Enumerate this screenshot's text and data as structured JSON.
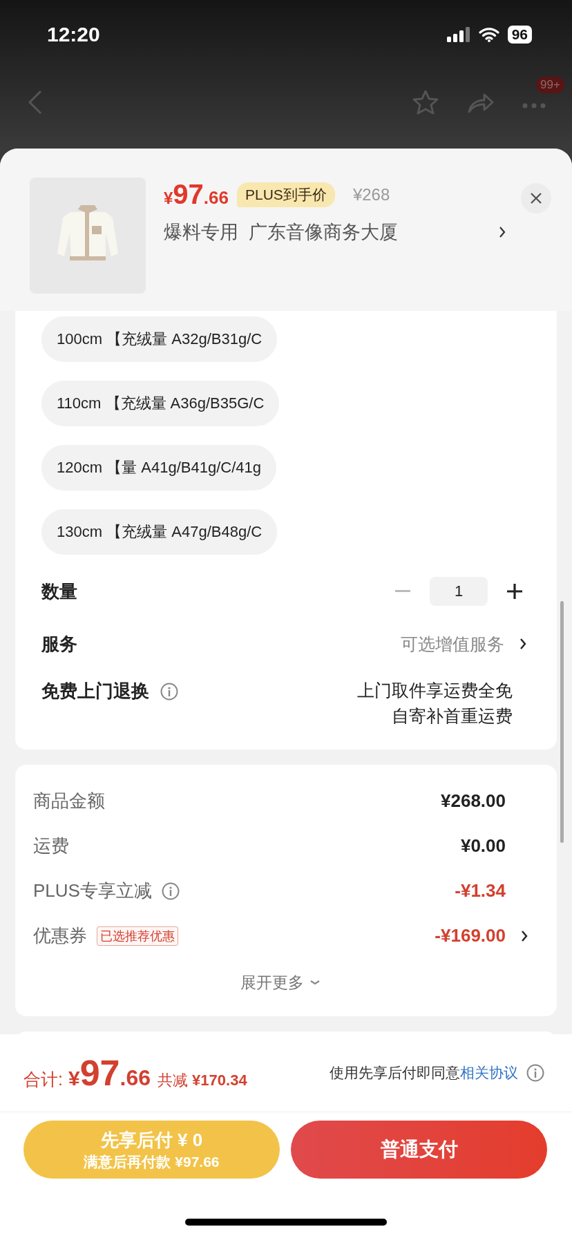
{
  "status_bar": {
    "time": "12:20",
    "battery": "96"
  },
  "nav": {
    "badge": "99+"
  },
  "product": {
    "price_symbol": "¥",
    "price_int": "97",
    "price_dec": ".66",
    "price_tag": "PLUS到手价",
    "original_price": "¥268",
    "name": "爆料专用  广东音像商务大厦"
  },
  "options": [
    {
      "label": "100cm 【充绒量 A32g/B31g/C",
      "selected": false
    },
    {
      "label": "110cm 【充绒量 A36g/B35G/C",
      "selected": false
    },
    {
      "label": "120cm 【量 A41g/B41g/C/41g",
      "selected": false
    },
    {
      "label": "130cm 【充绒量 A47g/B48g/C",
      "selected": false
    }
  ],
  "quantity": {
    "label": "数量",
    "value": "1",
    "minus_disabled": true
  },
  "service": {
    "label": "服务",
    "value": "可选增值服务"
  },
  "returns": {
    "label": "免费上门退换",
    "lines": [
      "上门取件享运费全免",
      "自寄补首重运费"
    ]
  },
  "summary": {
    "rows": [
      {
        "kind": "plain",
        "label": "商品金额",
        "value": "¥268.00",
        "discount": false
      },
      {
        "kind": "plain",
        "label": "运费",
        "value": "¥0.00",
        "discount": false
      },
      {
        "kind": "info",
        "label": "PLUS专享立减",
        "value": "-¥1.34",
        "discount": true
      },
      {
        "kind": "link",
        "label": "优惠券",
        "tag": "已选推荐优惠",
        "value": "-¥169.00",
        "discount": true
      }
    ],
    "expand": "展开更多"
  },
  "footer": {
    "total_label": "合计:",
    "total_symbol": "¥",
    "total_int": "97",
    "total_dec": ".66",
    "saved_label": "共减",
    "saved_value": "¥170.34",
    "agreement": "使用先享后付即同意",
    "agreement_link": "相关协议",
    "later_pay": [
      "先享后付 ¥ 0",
      "满意后再付款 ¥97.66"
    ],
    "pay": "普通支付"
  }
}
